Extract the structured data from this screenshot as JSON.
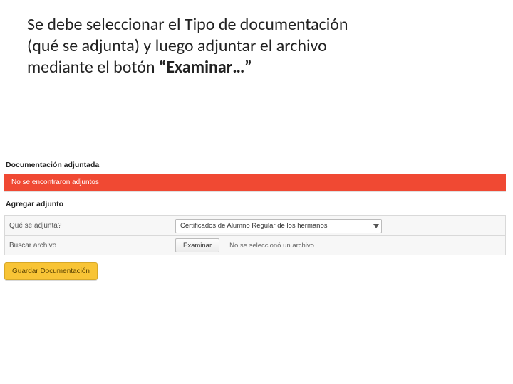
{
  "instruction": {
    "line1": "Se debe seleccionar el Tipo de documentación",
    "line2": "(qué se adjunta) y luego adjuntar el archivo",
    "line3_prefix": "mediante el botón ",
    "line3_bold": "“Examinar…”"
  },
  "sections": {
    "attached_title": "Documentación adjuntada",
    "empty_alert": "No se encontraron adjuntos",
    "add_title": "Agregar adjunto"
  },
  "form": {
    "type_label": "Qué se adjunta?",
    "type_selected": "Certificados de Alumno Regular de los hermanos",
    "file_label": "Buscar archivo",
    "browse_button": "Examinar",
    "file_status": "No se seleccionó un archivo"
  },
  "actions": {
    "save": "Guardar Documentación"
  }
}
